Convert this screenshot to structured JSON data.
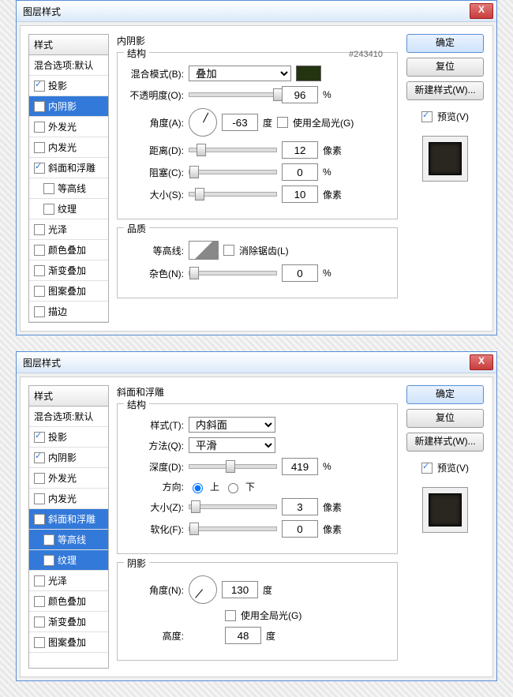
{
  "dialog_title": "图层样式",
  "close": "X",
  "styles_header": "样式",
  "blend_default": "混合选项:默认",
  "style_items": [
    {
      "l": "投影",
      "c": true
    },
    {
      "l": "内阴影",
      "c": true,
      "sel": 1
    },
    {
      "l": "外发光",
      "c": false
    },
    {
      "l": "内发光",
      "c": false
    },
    {
      "l": "斜面和浮雕",
      "c": true
    },
    {
      "l": "等高线",
      "sub": 1
    },
    {
      "l": "纹理",
      "sub": 1
    },
    {
      "l": "光泽",
      "c": false
    },
    {
      "l": "颜色叠加",
      "c": false
    },
    {
      "l": "渐变叠加",
      "c": false
    },
    {
      "l": "图案叠加",
      "c": false
    },
    {
      "l": "描边",
      "c": false
    }
  ],
  "style_items2": [
    {
      "l": "投影",
      "c": true
    },
    {
      "l": "内阴影",
      "c": true
    },
    {
      "l": "外发光",
      "c": false
    },
    {
      "l": "内发光",
      "c": false
    },
    {
      "l": "斜面和浮雕",
      "c": true,
      "sel": 1
    },
    {
      "l": "等高线",
      "sub": 1,
      "sel": 1
    },
    {
      "l": "纹理",
      "sub": 1,
      "sel": 1
    },
    {
      "l": "光泽",
      "c": false
    },
    {
      "l": "颜色叠加",
      "c": false
    },
    {
      "l": "渐变叠加",
      "c": false
    },
    {
      "l": "图案叠加",
      "c": false
    }
  ],
  "btn_ok": "确定",
  "btn_reset": "复位",
  "btn_new": "新建样式(W)...",
  "preview_label": "预览(V)",
  "p1": {
    "title": "内阴影",
    "g1": "结构",
    "g2": "品质",
    "blend": "混合模式(B):",
    "blend_v": "叠加",
    "hex": "#243410",
    "opacity": "不透明度(O):",
    "opacity_v": "96",
    "pct": "%",
    "angle": "角度(A):",
    "angle_v": "-63",
    "deg": "度",
    "global": "使用全局光(G)",
    "dist": "距离(D):",
    "dist_v": "12",
    "px": "像素",
    "choke": "阻塞(C):",
    "choke_v": "0",
    "size": "大小(S):",
    "size_v": "10",
    "contour": "等高线:",
    "anti": "消除锯齿(L)",
    "noise": "杂色(N):",
    "noise_v": "0"
  },
  "p2": {
    "title": "斜面和浮雕",
    "g1": "结构",
    "g2": "阴影",
    "style": "样式(T):",
    "style_v": "内斜面",
    "tech": "方法(Q):",
    "tech_v": "平滑",
    "depth": "深度(D):",
    "depth_v": "419",
    "dir": "方向:",
    "up": "上",
    "down": "下",
    "size": "大小(Z):",
    "size_v": "3",
    "px": "像素",
    "soft": "软化(F):",
    "soft_v": "0",
    "angle": "角度(N):",
    "angle_v": "130",
    "deg": "度",
    "global": "使用全局光(G)",
    "alt": "高度:",
    "alt_v": "48",
    "pct": "%"
  }
}
